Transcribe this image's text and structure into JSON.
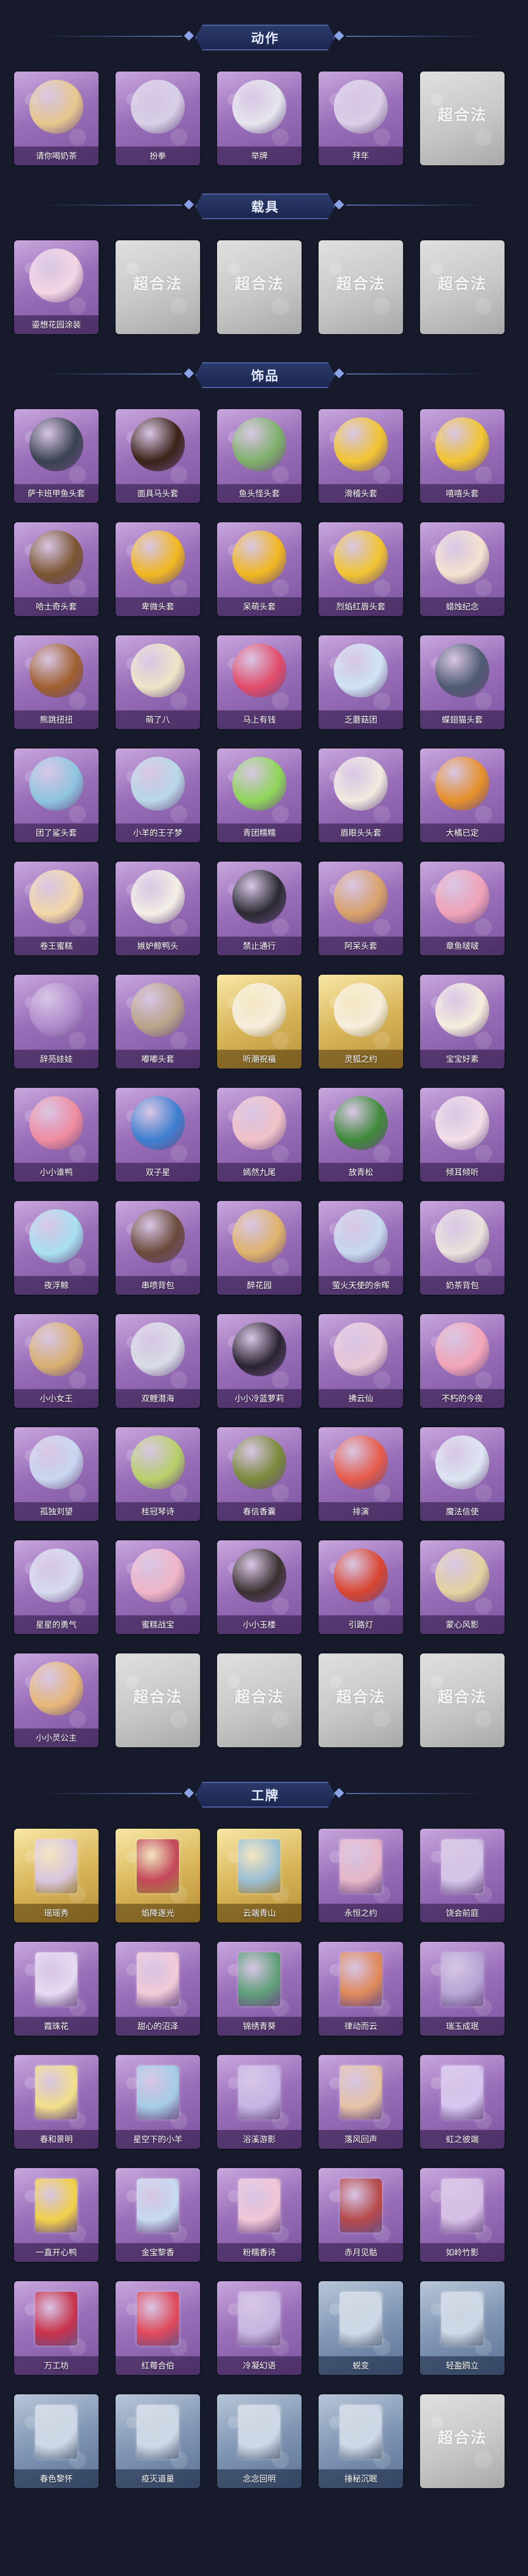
{
  "sections": [
    {
      "title": "动作",
      "items": [
        {
          "label": "请你喝奶茶",
          "tone": "purple",
          "icon": "milk-tea-icon",
          "color": "#e7c88e"
        },
        {
          "label": "扮拳",
          "tone": "purple",
          "icon": "fist-icon",
          "color": "#d8d0e6"
        },
        {
          "label": "举牌",
          "tone": "purple",
          "icon": "sign-icon",
          "color": "#e6e6ee"
        },
        {
          "label": "拜年",
          "tone": "purple",
          "icon": "bow-icon",
          "color": "#d9cfe6"
        },
        {
          "label": "超合法",
          "tone": "gray",
          "placeholder": true
        }
      ]
    },
    {
      "title": "载具",
      "items": [
        {
          "label": "鎏想花园涂装",
          "tone": "purple",
          "icon": "vehicle-icon",
          "color": "#f3d6e4"
        },
        {
          "label": "超合法",
          "tone": "gray",
          "placeholder": true
        },
        {
          "label": "超合法",
          "tone": "gray",
          "placeholder": true
        },
        {
          "label": "超合法",
          "tone": "gray",
          "placeholder": true
        },
        {
          "label": "超合法",
          "tone": "gray",
          "placeholder": true
        }
      ]
    },
    {
      "title": "饰品",
      "items": [
        {
          "label": "萨卡班甲鱼头套",
          "tone": "purple",
          "icon": "fish-head-icon",
          "color": "#3a4250"
        },
        {
          "label": "面具马头套",
          "tone": "purple",
          "icon": "horse-head-icon",
          "color": "#3a2217"
        },
        {
          "label": "鱼头怪头套",
          "tone": "purple",
          "icon": "fish-monster-icon",
          "color": "#7fb06a"
        },
        {
          "label": "滑稽头套",
          "tone": "purple",
          "icon": "funny-face-icon",
          "color": "#f2c530"
        },
        {
          "label": "嘻嘻头套",
          "tone": "purple",
          "icon": "grin-face-icon",
          "color": "#f2c530"
        },
        {
          "label": "哈士奇头套",
          "tone": "purple",
          "icon": "husky-icon",
          "color": "#7a5530"
        },
        {
          "label": "卑微头套",
          "tone": "purple",
          "icon": "humble-face-icon",
          "color": "#f2b820"
        },
        {
          "label": "呆萌头套",
          "tone": "purple",
          "icon": "dumb-face-icon",
          "color": "#f2b820"
        },
        {
          "label": "烈焰红唇头套",
          "tone": "purple",
          "icon": "pikachu-icon",
          "color": "#f2c530"
        },
        {
          "label": "蜡烛纪念",
          "tone": "purple",
          "icon": "candle-icon",
          "color": "#f4e3d0"
        },
        {
          "label": "熊跳扭扭",
          "tone": "purple",
          "icon": "dog-toy-icon",
          "color": "#a0602e"
        },
        {
          "label": "萌了八",
          "tone": "purple",
          "icon": "garlic-icon",
          "color": "#eee6c8"
        },
        {
          "label": "马上有钱",
          "tone": "purple",
          "icon": "mascot-icon",
          "color": "#e24c6a"
        },
        {
          "label": "乏蘑菇团",
          "tone": "purple",
          "icon": "ghost-icon",
          "color": "#cfe4f4"
        },
        {
          "label": "蝶翅猫头套",
          "tone": "purple",
          "icon": "cat-head-icon",
          "color": "#4d5a70"
        },
        {
          "label": "团了鲨头套",
          "tone": "purple",
          "icon": "shark-icon",
          "color": "#8fc6e0"
        },
        {
          "label": "小羊的王子梦",
          "tone": "purple",
          "icon": "sheep-icon",
          "color": "#b9d8e8"
        },
        {
          "label": "青团糯糯",
          "tone": "purple",
          "icon": "green-bun-icon",
          "color": "#8fd65a"
        },
        {
          "label": "眉眼头头套",
          "tone": "purple",
          "icon": "eyes-icon",
          "color": "#f1ebe0"
        },
        {
          "label": "大橘已定",
          "tone": "purple",
          "icon": "orange-icon",
          "color": "#e6902a"
        },
        {
          "label": "卷王蜜糕",
          "tone": "purple",
          "icon": "roll-cake-icon",
          "color": "#f2d8a8"
        },
        {
          "label": "嫉妒鲸鸭头",
          "tone": "purple",
          "icon": "duck-icon",
          "color": "#f3efe6"
        },
        {
          "label": "禁止通行",
          "tone": "purple",
          "icon": "traffic-cone-icon",
          "color": "#2a2a32"
        },
        {
          "label": "阿呆头套",
          "tone": "purple",
          "icon": "dog-face-icon",
          "color": "#d9a26a"
        },
        {
          "label": "章鱼啵啵",
          "tone": "purple",
          "icon": "octopus-icon",
          "color": "#f0a3b8"
        },
        {
          "label": "辞苑娃娃",
          "tone": "purple",
          "icon": "doll-icon",
          "color": "#b08ccd"
        },
        {
          "label": "嘟嘟头套",
          "tone": "purple",
          "icon": "cat-meme-icon",
          "color": "#b9a48a"
        },
        {
          "label": "听潮祝福",
          "tone": "gold",
          "icon": "angel-icon",
          "color": "#f6eedd"
        },
        {
          "label": "灵狐之约",
          "tone": "gold",
          "icon": "fox-spirit-icon",
          "color": "#f6eedd"
        },
        {
          "label": "宝宝好素",
          "tone": "purple",
          "icon": "baby-icon",
          "color": "#f6eedd"
        },
        {
          "label": "小小谁鸭",
          "tone": "purple",
          "icon": "peach-icon",
          "color": "#f08ca0"
        },
        {
          "label": "双子星",
          "tone": "purple",
          "icon": "twin-star-icon",
          "color": "#3e7fd0"
        },
        {
          "label": "嫣然九尾",
          "tone": "purple",
          "icon": "nine-tail-icon",
          "color": "#f2c2c8"
        },
        {
          "label": "放青松",
          "tone": "purple",
          "icon": "pine-icon",
          "color": "#3f8a3a"
        },
        {
          "label": "倾耳倾听",
          "tone": "purple",
          "icon": "wreath-icon",
          "color": "#f2dfe8"
        },
        {
          "label": "夜浮鲸",
          "tone": "purple",
          "icon": "jellyfish-icon",
          "color": "#a8e0f0"
        },
        {
          "label": "串喷背包",
          "tone": "purple",
          "icon": "cake-bag-icon",
          "color": "#6a4a3a"
        },
        {
          "label": "醉花园",
          "tone": "purple",
          "icon": "flower-globe-icon",
          "color": "#e0b36a"
        },
        {
          "label": "萤火天使的余晖",
          "tone": "purple",
          "icon": "dreamcatcher-icon",
          "color": "#c7d9ee"
        },
        {
          "label": "奶茶背包",
          "tone": "purple",
          "icon": "qr-bag-icon",
          "color": "#e9e3dc"
        },
        {
          "label": "小小女王",
          "tone": "purple",
          "icon": "queen-icon",
          "color": "#d9b070"
        },
        {
          "label": "双鲤潜海",
          "tone": "purple",
          "icon": "koi-icon",
          "color": "#d9dde6"
        },
        {
          "label": "小小冷蓝萝莉",
          "tone": "purple",
          "icon": "lolita-icon",
          "color": "#2a2330"
        },
        {
          "label": "拂云仙",
          "tone": "purple",
          "icon": "fairy-icon",
          "color": "#e9c8d8"
        },
        {
          "label": "不朽的今夜",
          "tone": "purple",
          "icon": "bouquet-icon",
          "color": "#f2a6b8"
        },
        {
          "label": "孤独刘望",
          "tone": "purple",
          "icon": "rabbit-charm-icon",
          "color": "#c9d7f0"
        },
        {
          "label": "桂冠琴诗",
          "tone": "purple",
          "icon": "lyre-icon",
          "color": "#b8d06a"
        },
        {
          "label": "春信香囊",
          "tone": "purple",
          "icon": "sachet-icon",
          "color": "#7a8a3a"
        },
        {
          "label": "排演",
          "tone": "purple",
          "icon": "fox-charm-icon",
          "color": "#e65c4a"
        },
        {
          "label": "魔法信使",
          "tone": "purple",
          "icon": "mouse-icon",
          "color": "#dde6f2"
        },
        {
          "label": "星星的勇气",
          "tone": "purple",
          "icon": "star-charm-icon",
          "color": "#d6dcef"
        },
        {
          "label": "蜜糕战宝",
          "tone": "purple",
          "icon": "heart-charm-icon",
          "color": "#f0b6c8"
        },
        {
          "label": "小小玉楼",
          "tone": "purple",
          "icon": "girl-charm-icon",
          "color": "#3a3030"
        },
        {
          "label": "引路灯",
          "tone": "purple",
          "icon": "lantern-icon",
          "color": "#d9452f"
        },
        {
          "label": "蒙心风影",
          "tone": "purple",
          "icon": "spirit-icon",
          "color": "#e3d3a0"
        },
        {
          "label": "小小灵公主",
          "tone": "purple",
          "icon": "princess-icon",
          "color": "#e8b878"
        },
        {
          "label": "超合法",
          "tone": "gray",
          "placeholder": true
        },
        {
          "label": "超合法",
          "tone": "gray",
          "placeholder": true
        },
        {
          "label": "超合法",
          "tone": "gray",
          "placeholder": true
        },
        {
          "label": "超合法",
          "tone": "gray",
          "placeholder": true
        }
      ]
    },
    {
      "title": "工牌",
      "items": [
        {
          "label": "瑶瑶秀",
          "tone": "gold",
          "icon": "badge-icon",
          "color": "#d9c6e0",
          "card": true
        },
        {
          "label": "焰降逐光",
          "tone": "gold",
          "icon": "badge-icon",
          "color": "#c2475a",
          "card": true
        },
        {
          "label": "云端青山",
          "tone": "gold",
          "icon": "badge-icon",
          "color": "#9bbfd6",
          "card": true
        },
        {
          "label": "永恒之约",
          "tone": "purple",
          "icon": "badge-icon",
          "color": "#e7b7c7",
          "card": true
        },
        {
          "label": "饶会前庭",
          "tone": "purple",
          "icon": "badge-icon",
          "color": "#d4c6e8",
          "card": true
        },
        {
          "label": "霞珠花",
          "tone": "purple",
          "icon": "badge-icon",
          "color": "#e6dcf2",
          "card": true
        },
        {
          "label": "甜心的沼泽",
          "tone": "purple",
          "icon": "badge-icon",
          "color": "#f2cbd8",
          "card": true
        },
        {
          "label": "锦绣青葵",
          "tone": "purple",
          "icon": "badge-icon",
          "color": "#5fa07a",
          "card": true
        },
        {
          "label": "律动而云",
          "tone": "purple",
          "icon": "badge-icon",
          "color": "#e08a5a",
          "card": true
        },
        {
          "label": "瑞玉成珉",
          "tone": "purple",
          "icon": "badge-icon",
          "color": "#b6a6d6",
          "card": true
        },
        {
          "label": "春和景明",
          "tone": "purple",
          "icon": "badge-icon",
          "color": "#f2e08a",
          "card": true
        },
        {
          "label": "星空下的小羊",
          "tone": "purple",
          "icon": "badge-icon",
          "color": "#a6cde6",
          "card": true
        },
        {
          "label": "浴溪游影",
          "tone": "purple",
          "icon": "badge-icon",
          "color": "#c6b6e6",
          "card": true
        },
        {
          "label": "落风回声",
          "tone": "purple",
          "icon": "badge-icon",
          "color": "#e6c4a6",
          "card": true
        },
        {
          "label": "虹之彼端",
          "tone": "purple",
          "icon": "badge-icon",
          "color": "#d6c6f0",
          "card": true
        },
        {
          "label": "一直开心鸭",
          "tone": "purple",
          "icon": "badge-icon",
          "color": "#f2d24a",
          "card": true
        },
        {
          "label": "金宝黎香",
          "tone": "purple",
          "icon": "badge-icon",
          "color": "#c6daf0",
          "card": true
        },
        {
          "label": "粉糯香诗",
          "tone": "purple",
          "icon": "badge-icon",
          "color": "#f2c6d8",
          "card": true
        },
        {
          "label": "赤月见骷",
          "tone": "purple",
          "icon": "badge-icon",
          "color": "#b64a4a",
          "card": true
        },
        {
          "label": "如岭竹影",
          "tone": "purple",
          "icon": "badge-icon",
          "color": "#d6c0e6",
          "card": true
        },
        {
          "label": "万工坊",
          "tone": "purple",
          "icon": "badge-icon",
          "color": "#c8324a",
          "card": true
        },
        {
          "label": "红莓合伯",
          "tone": "purple",
          "icon": "badge-icon",
          "color": "#e04a5a",
          "card": true
        },
        {
          "label": "冷凝幻语",
          "tone": "purple",
          "icon": "badge-icon",
          "color": "#c6b6e0",
          "card": true
        },
        {
          "label": "蜕变",
          "tone": "blue",
          "icon": "silhouette-icon",
          "color": "#cfd8e6",
          "card": true
        },
        {
          "label": "轻盈鸥立",
          "tone": "blue",
          "icon": "silhouette-icon",
          "color": "#cfd8e6",
          "card": true
        },
        {
          "label": "春色黎怀",
          "tone": "blue",
          "icon": "silhouette-icon",
          "color": "#cfd8e6",
          "card": true
        },
        {
          "label": "疫灭道量",
          "tone": "blue",
          "icon": "silhouette-icon",
          "color": "#cfd8e6",
          "card": true
        },
        {
          "label": "念念回明",
          "tone": "blue",
          "icon": "silhouette-icon",
          "color": "#cfd8e6",
          "card": true
        },
        {
          "label": "捶秘沉眠",
          "tone": "blue",
          "icon": "silhouette-icon",
          "color": "#cfd8e6",
          "card": true
        },
        {
          "label": "超合法",
          "tone": "gray",
          "placeholder": true
        }
      ]
    }
  ]
}
